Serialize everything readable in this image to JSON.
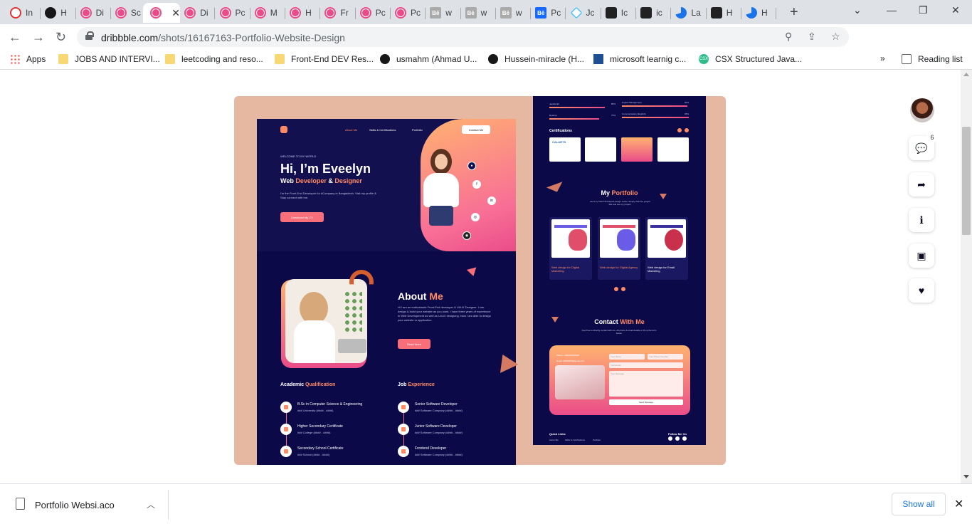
{
  "browser": {
    "tabs": [
      {
        "label": "In",
        "icon": "codewars-icon",
        "fav": "codewars"
      },
      {
        "label": "H",
        "icon": "github-icon",
        "fav": "github"
      },
      {
        "label": "Di",
        "icon": "dribbble-icon",
        "fav": "dribbble"
      },
      {
        "label": "Sc",
        "icon": "dribbble-icon",
        "fav": "dribbble"
      },
      {
        "label": "",
        "icon": "dribbble-icon",
        "fav": "dribbble",
        "active": true
      },
      {
        "label": "Di",
        "icon": "dribbble-icon",
        "fav": "dribbble"
      },
      {
        "label": "Pc",
        "icon": "dribbble-icon",
        "fav": "dribbble"
      },
      {
        "label": "M",
        "icon": "dribbble-icon",
        "fav": "dribbble"
      },
      {
        "label": "H",
        "icon": "dribbble-icon",
        "fav": "dribbble"
      },
      {
        "label": "Fr",
        "icon": "dribbble-icon",
        "fav": "dribbble"
      },
      {
        "label": "Pc",
        "icon": "dribbble-icon",
        "fav": "dribbble"
      },
      {
        "label": "Pc",
        "icon": "dribbble-icon",
        "fav": "dribbble"
      },
      {
        "label": "w",
        "icon": "behance-icon",
        "fav": "behance"
      },
      {
        "label": "w",
        "icon": "behance-icon",
        "fav": "behance"
      },
      {
        "label": "w",
        "icon": "behance-icon",
        "fav": "behance"
      },
      {
        "label": "Pc",
        "icon": "behance-icon",
        "fav": "behance blue"
      },
      {
        "label": "Jc",
        "icon": "diamond-icon",
        "fav": "diamond"
      },
      {
        "label": "Ic",
        "icon": "codesandbox-icon",
        "fav": "dark"
      },
      {
        "label": "ic",
        "icon": "pixel-icon",
        "fav": "dark"
      },
      {
        "label": "La",
        "icon": "loading-icon",
        "fav": "grad"
      },
      {
        "label": "H",
        "icon": "tag-icon",
        "fav": "dark"
      },
      {
        "label": "H",
        "icon": "loading-icon",
        "fav": "grad"
      }
    ],
    "url_host": "dribbble.com",
    "url_path": "/shots/16167163-Portfolio-Website-Design",
    "profile_initial": "H",
    "bookmarks": [
      {
        "label": "Apps",
        "icon": "apps-icon",
        "cls": "apps"
      },
      {
        "label": "JOBS AND INTERVI...",
        "icon": "folder-icon",
        "cls": "folder"
      },
      {
        "label": "leetcoding and reso...",
        "icon": "folder-icon",
        "cls": "folder"
      },
      {
        "label": "Front-End DEV Res...",
        "icon": "folder-icon",
        "cls": "folder"
      },
      {
        "label": "usmahm (Ahmad U...",
        "icon": "github-icon",
        "cls": "gh"
      },
      {
        "label": "Hussein-miracle (H...",
        "icon": "github-icon",
        "cls": "gh"
      },
      {
        "label": "microsoft learnig c...",
        "icon": "microsoft-icon",
        "cls": "ms"
      },
      {
        "label": "CSX Structured Java...",
        "icon": "csx-icon",
        "cls": "csx"
      }
    ],
    "reading_list": "Reading list",
    "more_bookmarks": "»",
    "csx_badge": "CSX"
  },
  "shot": {
    "nav": [
      "About Me",
      "Skills & Certifications",
      "Portfolio"
    ],
    "contact_button": "Contact Me",
    "welcome": "WELCOME TO MY WORLD",
    "name": "Hi, I’m Eveelyn",
    "role_pre": "Web",
    "role_dev": "Developer",
    "role_amp": "&",
    "role_designer": "Designer",
    "hero_desc": "I'm the Front-End Developer for #Company in Bangladesh. Visit my profile & Stay connect with me.",
    "cta": "Download My CV",
    "about_title": "About",
    "about_accent": "Me",
    "about_desc": "Hi I am an enthusiastic Front-End developer & UI/UX Designer. I can design & build your website as you want. I have three years of experience in Web Development as well as UI/UX designing. Now I am able to design your website or application.",
    "read_more": "Read More",
    "academic_title": "Academic",
    "academic_accent": "Qualification",
    "job_title": "Job",
    "job_accent": "Experience",
    "academic": [
      {
        "title": "B.Sc in Computer Science & Engineering",
        "sub": "### University (#### - ####)"
      },
      {
        "title": "Higher Secondary Certificate",
        "sub": "### College (#### - ####)"
      },
      {
        "title": "Secondary School Certificate",
        "sub": "### School (#### - ####)"
      }
    ],
    "jobs": [
      {
        "title": "Senior Software Developer",
        "sub": "### Software Company (#### - ####)"
      },
      {
        "title": "Junior Software Developer",
        "sub": "### Software Company (#### - ####)"
      },
      {
        "title": "Frontend Developer",
        "sub": "### Software Company (#### - ####)"
      }
    ],
    "skills": [
      {
        "label": "JavaScript",
        "pct": "85%",
        "label2": "Project Management",
        "pct2": "90%"
      },
      {
        "label": "React.js",
        "pct": "75%",
        "label2": "Communication (English)",
        "pct2": "95%"
      }
    ],
    "certifications_title": "Certifications",
    "cert_logo": "CALARTS",
    "portfolio_title": "My",
    "portfolio_accent": "Portfolio",
    "portfolio_desc": "All of my latest developed design works. Simply click the project title and see my project.",
    "portfolio_items": [
      {
        "label": "Web design for Digital Marketing"
      },
      {
        "label": "Web design for Digital Agency"
      },
      {
        "label": "Web design for Email Marketing"
      }
    ],
    "contact_title": "Contact",
    "contact_accent": "With Me",
    "contact_desc": "Feel free to directly contact with me. All phone & email details or fill up the form below.",
    "contact_phone": "Phone: +880#########",
    "contact_email": "Email: ########@gmail.com",
    "form_name": "Your Name",
    "form_phone": "Your Phone Number",
    "form_email": "Your Email",
    "form_message": "Your Message",
    "form_send": "Send Message",
    "quick_links": "Quick Links",
    "quick_items": [
      "About Me",
      "Skills & Certifications",
      "Portfolio"
    ],
    "follow": "Follow Me On"
  },
  "sidebar": {
    "comments_count": "6"
  },
  "downloads": {
    "file_name": "Portfolio Websi.aco",
    "show_all": "Show all"
  }
}
